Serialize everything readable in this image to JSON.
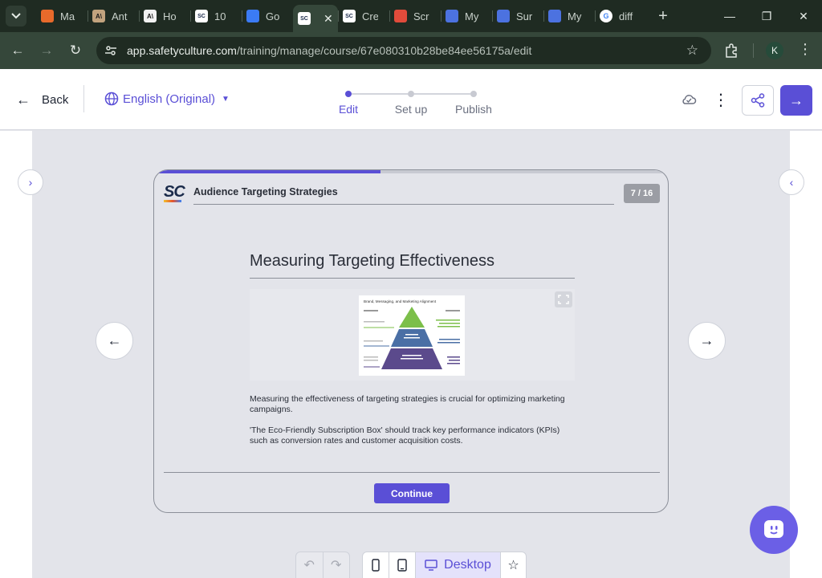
{
  "browser": {
    "tabs": [
      {
        "label": "Ma",
        "icon": "orange-squares-icon",
        "color": "#e86a2b"
      },
      {
        "label": "Ant",
        "icon": "anthropic-icon",
        "color": "#c2a37e"
      },
      {
        "label": "Ho",
        "icon": "anthropic-icon",
        "color": "#f2f2f2"
      },
      {
        "label": "10",
        "icon": "safetyculture-icon",
        "color": "#ffffff"
      },
      {
        "label": "Go",
        "icon": "butterfly-icon",
        "color": "#3b7bf5"
      },
      {
        "label": "",
        "icon": "safetyculture-icon",
        "color": "#ffffff",
        "active": true
      },
      {
        "label": "Cre",
        "icon": "safetyculture-icon",
        "color": "#ffffff"
      },
      {
        "label": "Scr",
        "icon": "image-icon",
        "color": "#e14b3b"
      },
      {
        "label": "My",
        "icon": "chat-icon",
        "color": "#4c72e0"
      },
      {
        "label": "Sur",
        "icon": "chat-icon",
        "color": "#4c72e0"
      },
      {
        "label": "My",
        "icon": "chat-icon",
        "color": "#4c72e0"
      },
      {
        "label": "diff",
        "icon": "google-icon",
        "color": "#ffffff"
      }
    ],
    "url_host": "app.safetyculture.com",
    "url_path": "/training/manage/course/67e080310b28be84ee56175a/edit",
    "profile_initial": "K"
  },
  "header": {
    "back_label": "Back",
    "language_label": "English (Original)",
    "steps": [
      "Edit",
      "Set up",
      "Publish"
    ],
    "active_step": 0
  },
  "slide": {
    "course_title": "Audience Targeting Strategies",
    "page_indicator": "7 / 16",
    "progress": 0.44,
    "lesson_title": "Measuring Targeting Effectiveness",
    "infographic_title": "Brand, Messaging, and Marketing Alignment",
    "paragraph_1": "Measuring the effectiveness of targeting strategies is crucial for optimizing marketing campaigns.",
    "paragraph_2": "'The Eco-Friendly Subscription Box' should track key performance indicators (KPIs) such as conversion rates and customer acquisition costs.",
    "continue_label": "Continue"
  },
  "toolbar": {
    "desktop_label": "Desktop"
  },
  "colors": {
    "accent": "#5a4fd6",
    "chrome_dark": "#1f2b22",
    "chrome_mid": "#35473a"
  }
}
